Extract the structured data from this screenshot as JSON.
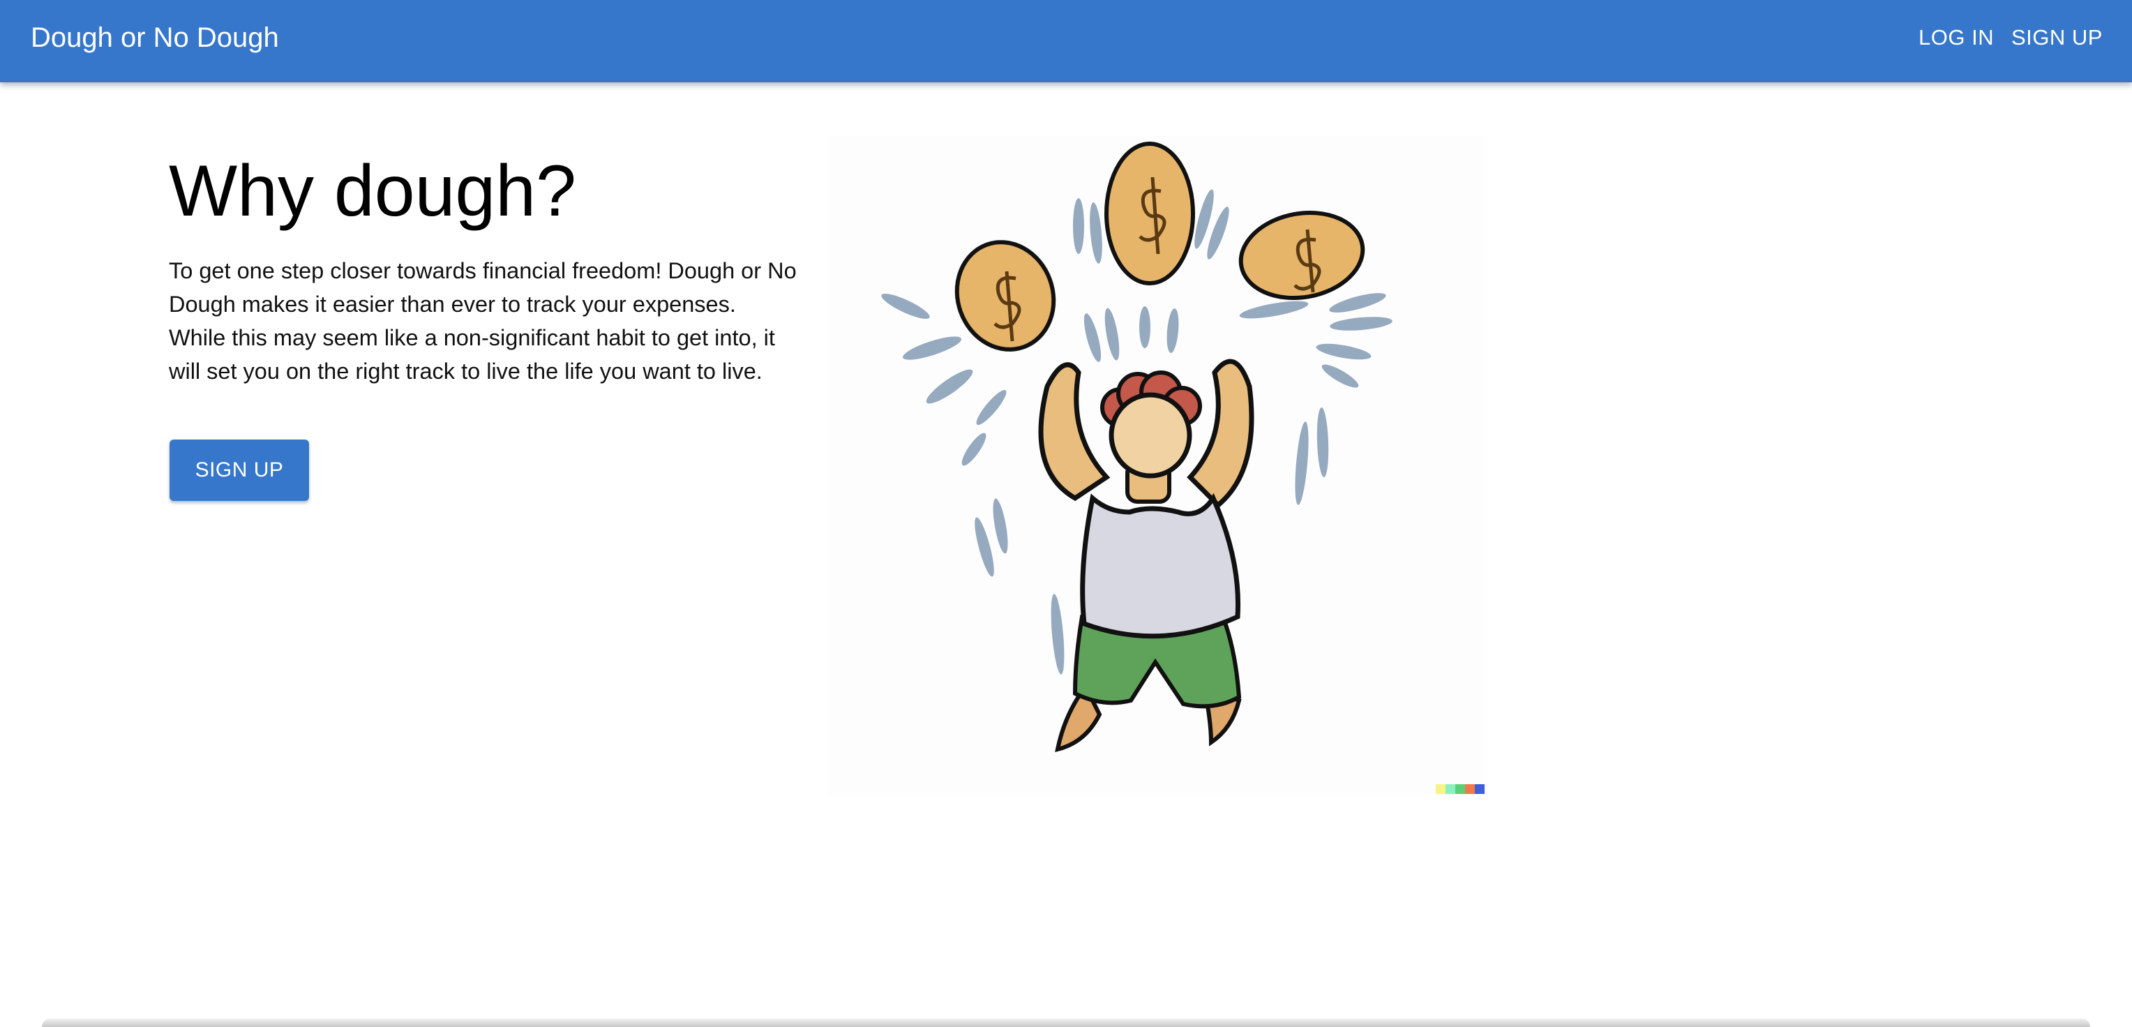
{
  "appbar": {
    "brand": "Dough or No Dough",
    "login_label": "LOG IN",
    "signup_label": "SIGN UP"
  },
  "hero": {
    "title": "Why dough?",
    "body": "To get one step closer towards financial freedom! Dough or No Dough makes it easier than ever to track your expenses. While this may seem like a non-significant habit to get into, it will set you on the right track to live the life you want to live.",
    "cta_label": "SIGN UP"
  },
  "colors": {
    "appbar": "#3677cc",
    "button": "#3677cc",
    "text": "#000000"
  },
  "illustration": {
    "icon": "juggling-dough-character-illustration"
  }
}
